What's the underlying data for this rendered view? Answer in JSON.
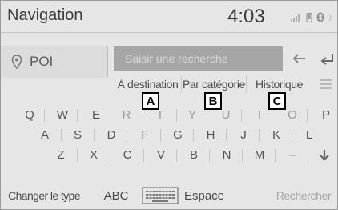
{
  "header": {
    "title": "Navigation",
    "clock": "4:03"
  },
  "poi": {
    "label": "POI"
  },
  "search": {
    "placeholder": "Saisir une recherche"
  },
  "filters": {
    "destination": "À destination",
    "category": "Par catégorie",
    "history": "Historique"
  },
  "callouts": {
    "a": "A",
    "b": "B",
    "c": "C"
  },
  "keyboard": {
    "row1": [
      "Q",
      "W",
      "E",
      "R",
      "T",
      "Y",
      "U",
      "I",
      "O",
      "P"
    ],
    "row2": [
      "A",
      "S",
      "D",
      "F",
      "G",
      "H",
      "J",
      "K",
      "L"
    ],
    "row3": [
      "Z",
      "X",
      "C",
      "V",
      "B",
      "N",
      "M",
      "–"
    ]
  },
  "bottom": {
    "change_type": "Changer le type",
    "abc": "ABC",
    "space": "Espace",
    "search": "Rechercher"
  },
  "colors": {
    "background": "#e6e6e6",
    "input_bg": "#a6a6a6",
    "text": "#4a4a4a",
    "disabled_text": "#a5a5a5"
  }
}
